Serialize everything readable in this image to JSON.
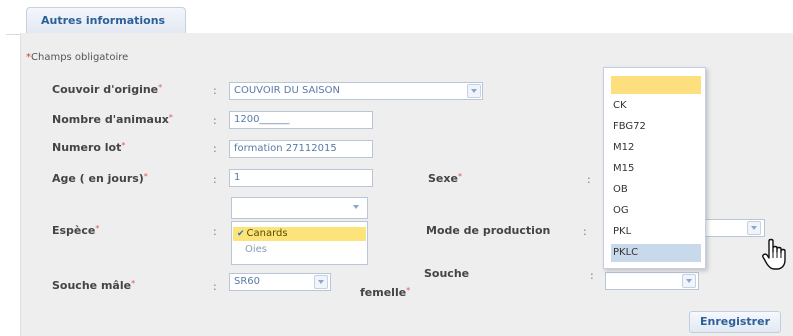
{
  "tab": {
    "label": "Autres informations"
  },
  "required_note": {
    "star": "*",
    "text": "Champs obligatoire"
  },
  "colon": ":",
  "form": {
    "couvoir": {
      "label": "Couvoir d'origine",
      "value": "COUVOIR DU SAISON"
    },
    "nombre": {
      "label": "Nombre d'animaux",
      "value": "1200______"
    },
    "lot": {
      "label": "Numero lot",
      "value": "formation 27112015"
    },
    "age": {
      "label": "Age ( en jours)",
      "value": "1"
    },
    "sexe": {
      "label": "Sexe"
    },
    "espece": {
      "label": "Espèce",
      "options": [
        "Canards",
        "Oies"
      ],
      "selected": "Canards"
    },
    "mode_production": {
      "label": "Mode de production"
    },
    "souche_male": {
      "label": "Souche mâle",
      "value": "SR60"
    },
    "souche_femelle": {
      "label_line1": "Souche",
      "label_line2": "femelle"
    }
  },
  "dropdown": {
    "options": [
      "",
      "CK",
      "FBG72",
      "M12",
      "M15",
      "OB",
      "OG",
      "PKL",
      "PKLC"
    ],
    "hovered": "PKLC"
  },
  "buttons": {
    "save": "Enregistrer"
  },
  "colors": {
    "accent": "#2d5f99",
    "required": "#e05555",
    "selected_item": "#fce47a",
    "hover_item": "#c9d9ec"
  }
}
